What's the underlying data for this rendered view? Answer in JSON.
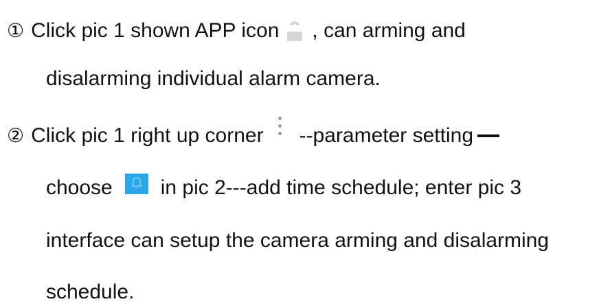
{
  "item1": {
    "number": "①",
    "line1_before_icon": "Click pic 1 shown APP icon",
    "line1_after_icon": ", can arming and",
    "line2": "disalarming individual alarm camera.",
    "icon": "unlocked-padlock-icon"
  },
  "item2": {
    "number": "②",
    "line1_before_icon": "Click pic 1 right up corner",
    "line1_after_icon": "--parameter setting",
    "line2_before_icon": "choose",
    "line2_after_icon": "in pic 2---add time schedule; enter pic 3",
    "line3": "interface can setup the camera arming and disalarming",
    "line4": "schedule.",
    "icon_more": "kebab-menu-icon",
    "icon_bell": "alarm-bell-icon",
    "bell_color": "#29a7e8"
  }
}
